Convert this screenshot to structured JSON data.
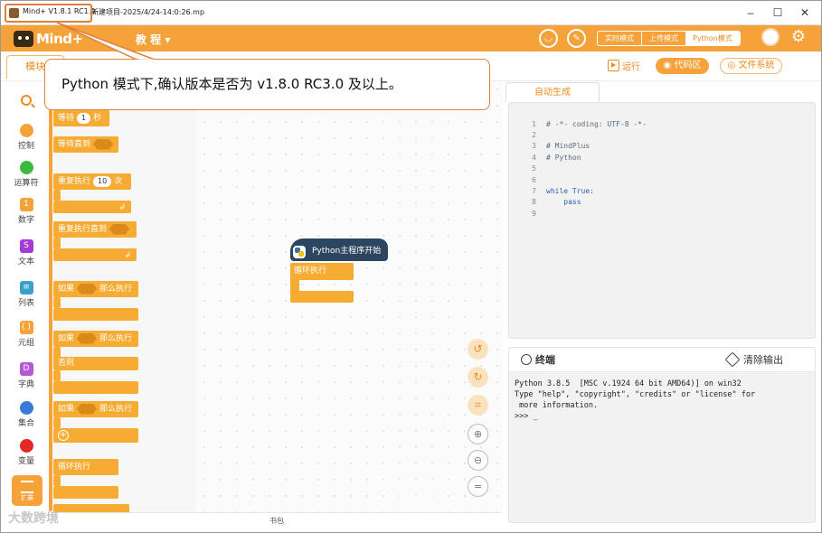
{
  "window": {
    "title": "Mind+ V1.8.1 RC1.0",
    "project": "新建项目-2025/4/24-14:0:26.mp",
    "minimize": "–",
    "maximize": "☐",
    "close": "✕"
  },
  "header": {
    "logo": "Mind+",
    "menu_tutorial": "教 程 ▾",
    "modes": [
      "实时模式",
      "上传模式",
      "Python模式"
    ]
  },
  "subbar": {
    "module_tab": "模块",
    "run": "运行",
    "code_area": "代码区",
    "file_system": "文件系统"
  },
  "categories": [
    "控制",
    "运算符",
    "数字",
    "文本",
    "列表",
    "元组",
    "字典",
    "集合",
    "变量"
  ],
  "category_colors": {
    "control": "#f6a23a",
    "operators": "#3db843",
    "numbers": "#f6a23a",
    "text": "#a53ad6",
    "list": "#3aa0c8",
    "tuple": "#f6a23a",
    "dict": "#b25ad6",
    "set": "#3a7ad6",
    "variable": "#e32828"
  },
  "extension_label": "扩展",
  "blocks": {
    "wait": "等待",
    "wait_value": "1",
    "wait_unit": "秒",
    "wait_until": "等待直到",
    "repeat": "重复执行",
    "repeat_value": "10",
    "repeat_unit": "次",
    "repeat_until": "重复执行直到",
    "if1": "如果",
    "then1": "那么执行",
    "if2": "如果",
    "then2": "那么执行",
    "else2": "否则",
    "if3": "如果",
    "then3": "那么执行",
    "forever": "循环执行"
  },
  "bookbag": "书包",
  "workspace": {
    "hat_block": "Python主程序开始",
    "loop_block": "循环执行"
  },
  "code": {
    "tab": "自动生成",
    "line_numbers": [
      "1",
      "2",
      "3",
      "4",
      "5",
      "6",
      "7",
      "8",
      "9"
    ],
    "lines": [
      "# -*- coding: UTF-8 -*-",
      "",
      "# MindPlus",
      "# Python",
      "",
      "",
      "while True:",
      "    pass",
      ""
    ]
  },
  "terminal": {
    "title": "终端",
    "clear": "清除输出",
    "lines": [
      "Python 3.8.5  [MSC v.1924 64 bit AMD64)] on win32",
      "Type \"help\", \"copyright\", \"credits\" or \"license\" for",
      " more information.",
      ">>> _"
    ]
  },
  "annotation": {
    "callout_text": "Python 模式下,确认版本是否为 v1.8.0 RC3.0 及以上。",
    "accent": "#e0803a"
  },
  "watermark": "大数跨境"
}
